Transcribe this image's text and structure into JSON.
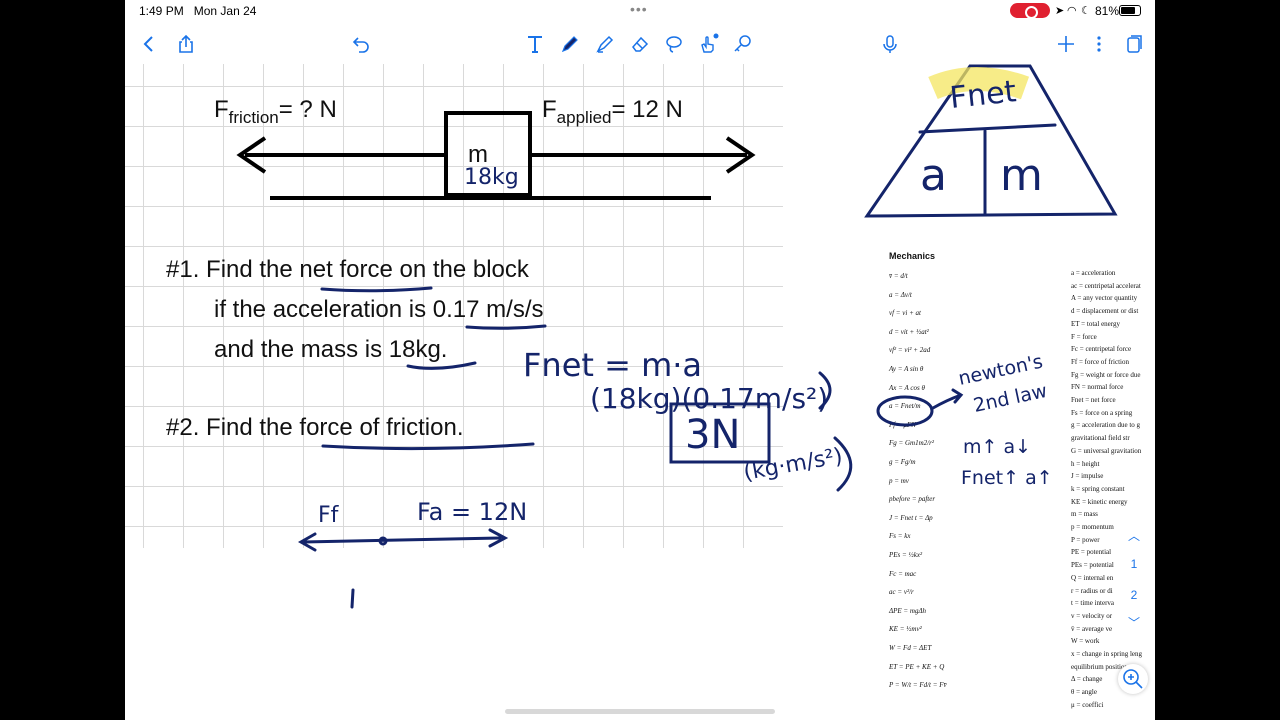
{
  "status_bar": {
    "time": "1:49 PM",
    "date": "Mon Jan 24",
    "battery": "81%"
  },
  "toolbar": {
    "icons": [
      "back-icon",
      "share-icon",
      "undo-icon",
      "text-tool-icon",
      "pen-icon",
      "highlighter-icon",
      "eraser-icon",
      "lasso-icon",
      "hand-touch-icon",
      "link-icon",
      "microphone-icon",
      "add-icon",
      "more-icon",
      "pages-icon"
    ],
    "accent_color": "#1a73e8"
  },
  "diagram": {
    "friction_label_f": "F",
    "friction_label_sub": "friction",
    "friction_value": "= ? N",
    "applied_label_f": "F",
    "applied_label_sub": "applied",
    "applied_value": "= 12 N",
    "block_label": "m",
    "block_handwritten": "18kg"
  },
  "problems": {
    "p1_line1": "#1. Find the net force on the block",
    "p1_line2": "if the acceleration is 0.17 m/s/s",
    "p1_line3": "and the mass is 18kg.",
    "p2": "#2. Find the force of friction."
  },
  "handwriting": {
    "eq1": "Fnet = m·a",
    "eq2": "(18kg)(0.17m/s²)",
    "answer": "3N",
    "units": "(kg·m/s²)",
    "note1": "newton's",
    "note2": "2nd law",
    "note3": "m↑ a↓",
    "note4": "Fnet↑ a↑",
    "ff": "Ff",
    "fa": "Fa = 12N",
    "triangle_top": "Fnet",
    "triangle_left": "a",
    "triangle_right": "m"
  },
  "reference_sheet": {
    "title": "Mechanics",
    "equations": [
      "v̄ = d/t",
      "a = Δv/t",
      "vf = vi + at",
      "d = vit + ½at²",
      "vf² = vi² + 2ad",
      "Ay = A sin θ",
      "Ax = A cos θ",
      "a = Fnet/m",
      "Ff = μFN",
      "Fg = Gm1m2/r²",
      "g = Fg/m",
      "p = mv",
      "pbefore = pafter",
      "J = Fnet t = Δp",
      "Fs = kx",
      "PEs = ½kx²",
      "Fc = mac",
      "ac = v²/r",
      "ΔPE = mgΔh",
      "KE = ½mv²",
      "W = Fd = ΔET",
      "ET = PE + KE + Q",
      "P = W/t = Fd/t = Fv̄"
    ],
    "definitions": [
      "a = acceleration",
      "ac = centripetal accelerat",
      "A = any vector quantity",
      "d = displacement or dist",
      "ET = total energy",
      "F = force",
      "Fc = centripetal force",
      "Ff = force of friction",
      "Fg = weight or force due",
      "FN = normal force",
      "Fnet = net force",
      "Fs = force on a spring",
      "g = acceleration due to g",
      "gravitational field str",
      "G = universal gravitation",
      "h = height",
      "J = impulse",
      "k = spring constant",
      "KE = kinetic energy",
      "m = mass",
      "p = momentum",
      "P = power",
      "PE = potential",
      "PEs = potential",
      "Q = internal en",
      "r = radius or di",
      "t = time interva",
      "v = velocity or",
      "v̄ = average ve",
      "W = work",
      "x = change in spring leng",
      "equilibrium position",
      "Δ = change",
      "θ = angle",
      "μ = coeffici"
    ],
    "page_current": "1",
    "page_total": "2"
  }
}
